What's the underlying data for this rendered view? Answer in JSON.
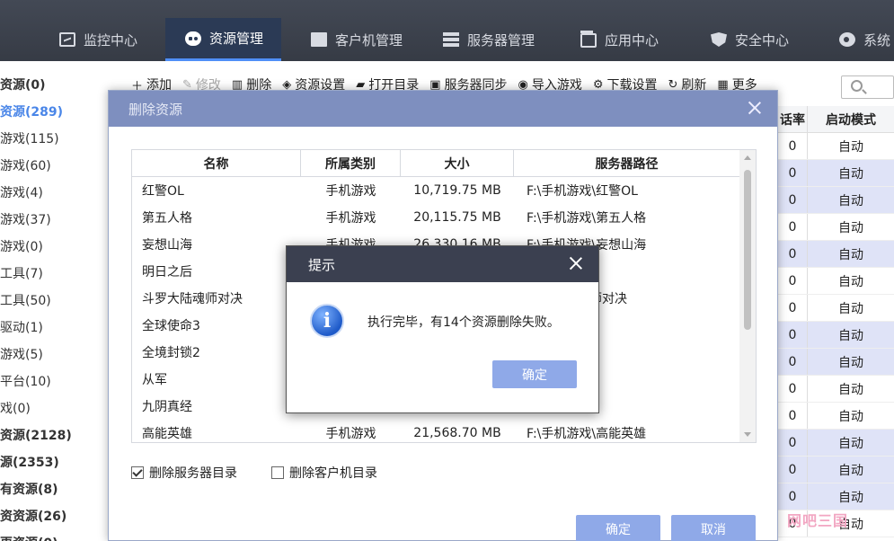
{
  "nav": {
    "items": [
      {
        "label": "监控中心",
        "icon": "monitor-icon"
      },
      {
        "label": "资源管理",
        "icon": "gamepad-icon"
      },
      {
        "label": "客户机管理",
        "icon": "pc-icon"
      },
      {
        "label": "服务器管理",
        "icon": "server-icon"
      },
      {
        "label": "应用中心",
        "icon": "app-icon"
      },
      {
        "label": "安全中心",
        "icon": "shield-icon"
      },
      {
        "label": "系统",
        "icon": "gear-icon"
      }
    ]
  },
  "tree": {
    "items": [
      "资源(0)",
      "资源(289)",
      "游戏(115)",
      "游戏(60)",
      "游戏(4)",
      "游戏(37)",
      "游戏(0)",
      "工具(7)",
      "工具(50)",
      "驱动(1)",
      "游戏(5)",
      "平台(10)",
      "戏(0)",
      "资源(2128)",
      "源(2353)",
      "有资源(8)",
      "资资源(26)",
      "更资源(0)"
    ]
  },
  "toolbar": {
    "add": "添加",
    "edit": "修改",
    "delete": "删除",
    "res_settings": "资源设置",
    "open_dir": "打开目录",
    "server_sync": "服务器同步",
    "import_game": "导入游戏",
    "download_settings": "下载设置",
    "refresh": "刷新",
    "more": "更多"
  },
  "bg_table": {
    "col1": "话率",
    "col2": "启动模式",
    "rows": [
      {
        "v": "0",
        "m": "自动"
      },
      {
        "v": "0",
        "m": "自动"
      },
      {
        "v": "0",
        "m": "自动"
      },
      {
        "v": "0",
        "m": "自动"
      },
      {
        "v": "0",
        "m": "自动"
      },
      {
        "v": "0",
        "m": "自动"
      },
      {
        "v": "0",
        "m": "自动"
      },
      {
        "v": "0",
        "m": "自动"
      },
      {
        "v": "0",
        "m": "自动"
      },
      {
        "v": "0",
        "m": "自动"
      },
      {
        "v": "0",
        "m": "自动"
      },
      {
        "v": "0",
        "m": "自动"
      },
      {
        "v": "0",
        "m": "自动"
      },
      {
        "v": "0",
        "m": "自动"
      },
      {
        "v": "0",
        "m": "自动"
      }
    ]
  },
  "delete_dialog": {
    "title": "删除资源",
    "headers": {
      "name": "名称",
      "category": "所属类别",
      "size": "大小",
      "path": "服务器路径"
    },
    "rows": [
      {
        "name": "红警OL",
        "category": "手机游戏",
        "size": "10,719.75 MB",
        "path": "F:\\手机游戏\\红警OL"
      },
      {
        "name": "第五人格",
        "category": "手机游戏",
        "size": "20,115.75 MB",
        "path": "F:\\手机游戏\\第五人格"
      },
      {
        "name": "妄想山海",
        "category": "手机游戏",
        "size": "26,330.16 MB",
        "path": "F:\\手机游戏\\妄想山海"
      },
      {
        "name": "明日之后",
        "category": "",
        "size": "",
        "path": "明日之后"
      },
      {
        "name": "斗罗大陆魂师对决",
        "category": "",
        "size": "",
        "path": "斗罗大陆魂师对决"
      },
      {
        "name": "全球使命3",
        "category": "",
        "size": "",
        "path": "全球使命3"
      },
      {
        "name": "全境封锁2",
        "category": "",
        "size": "",
        "path": "全境封锁2"
      },
      {
        "name": "从军",
        "category": "",
        "size": "",
        "path": "从军"
      },
      {
        "name": "九阴真经",
        "category": "",
        "size": "",
        "path": "九阴真经"
      },
      {
        "name": "高能英雄",
        "category": "手机游戏",
        "size": "21,568.70 MB",
        "path": "F:\\手机游戏\\高能英雄"
      }
    ],
    "chk_server": "删除服务器目录",
    "chk_client": "删除客户机目录",
    "ok": "确定",
    "cancel": "取消"
  },
  "prompt": {
    "title": "提示",
    "message": "执行完毕，有14个资源删除失败。",
    "ok": "确定"
  },
  "watermark": "网吧三国"
}
